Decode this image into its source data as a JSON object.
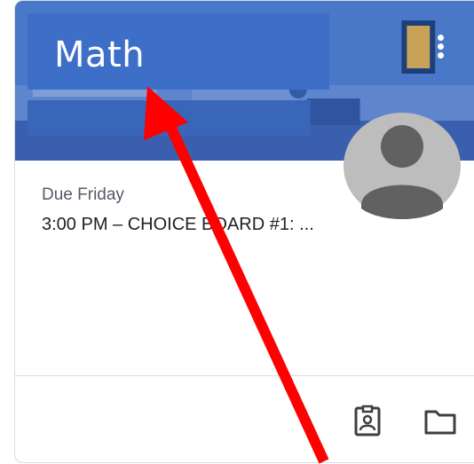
{
  "card": {
    "title": "Math",
    "due_label": "Due Friday",
    "due_item": "3:00 PM – CHOICE BOARD #1: ..."
  },
  "icons": {
    "menu": "more-vert-icon",
    "avatar": "person-avatar-icon",
    "work": "assignment-ind-icon",
    "folder": "folder-icon"
  },
  "colors": {
    "header": "#3f6ec6",
    "arrow": "#ff0000"
  }
}
